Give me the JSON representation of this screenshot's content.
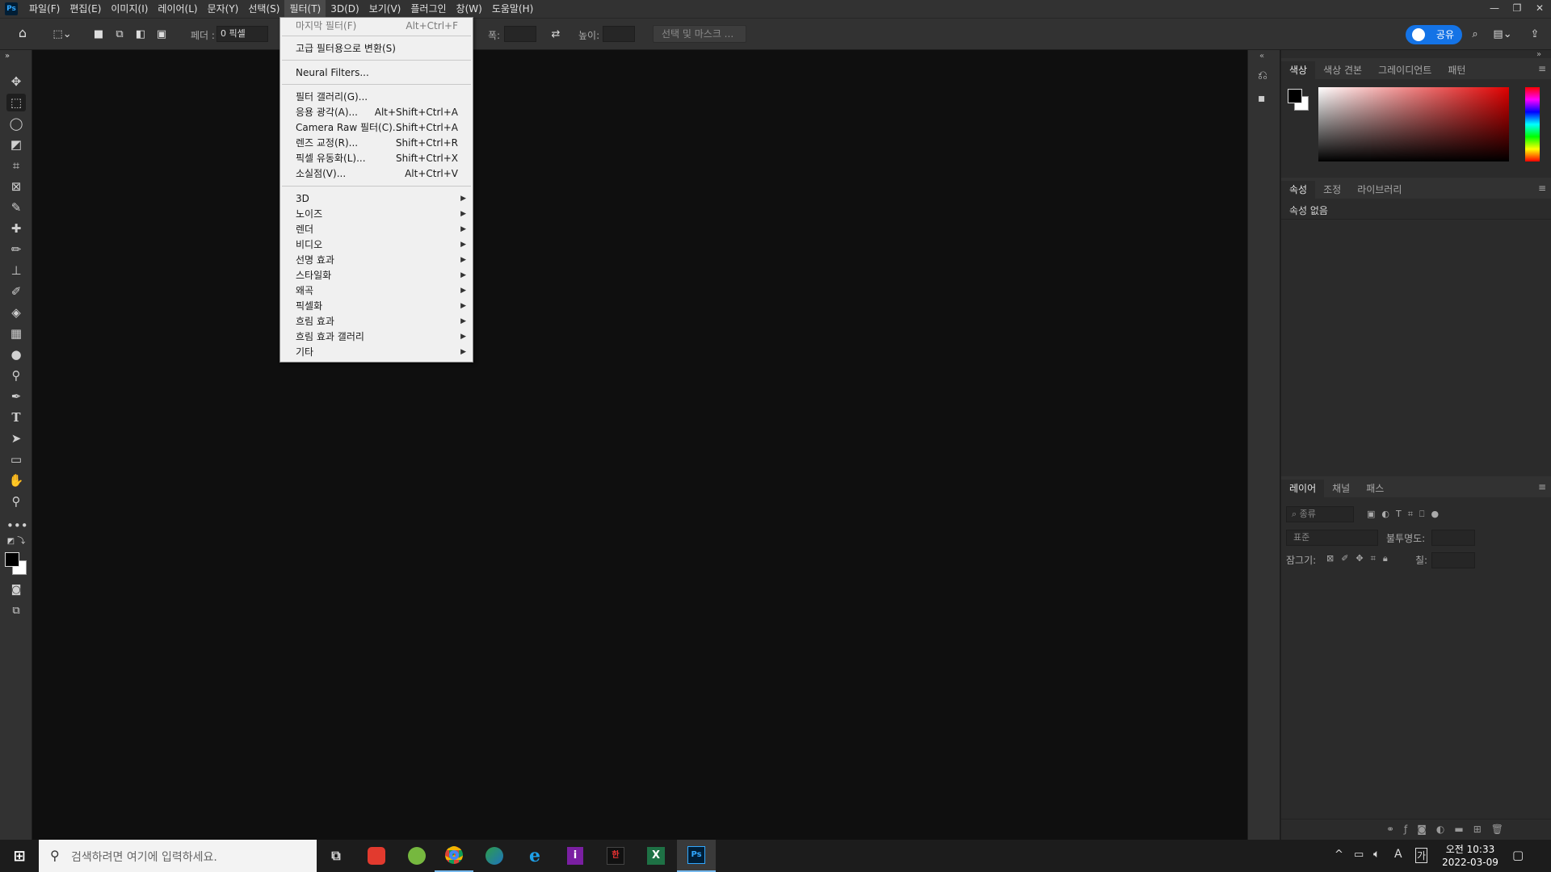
{
  "menubar": {
    "logo": "Ps",
    "items": [
      "파일(F)",
      "편집(E)",
      "이미지(I)",
      "레이어(L)",
      "문자(Y)",
      "선택(S)",
      "필터(T)",
      "3D(D)",
      "보기(V)",
      "플러그인",
      "창(W)",
      "도움말(H)"
    ],
    "window_controls": [
      "—",
      "❐",
      "✕"
    ]
  },
  "options": {
    "feather_label": "페더 :",
    "feather_value": "0 픽셀",
    "width_label": "폭:",
    "height_label": "높이:",
    "select_mask_label": "선택 및 마스크 ...",
    "share_label": "공유"
  },
  "filter_menu": {
    "last_filter": {
      "label": "마지막 필터(F)",
      "shortcut": "Alt+Ctrl+F"
    },
    "convert_smart": {
      "label": "고급 필터용으로 변환(S)"
    },
    "neural": {
      "label": "Neural Filters..."
    },
    "gallery": {
      "label": "필터 갤러리(G)..."
    },
    "adaptive": {
      "label": "응용 광각(A)...",
      "shortcut": "Alt+Shift+Ctrl+A"
    },
    "camera_raw": {
      "label": "Camera Raw 필터(C)...",
      "shortcut": "Shift+Ctrl+A"
    },
    "lens": {
      "label": "렌즈 교정(R)...",
      "shortcut": "Shift+Ctrl+R"
    },
    "liquify": {
      "label": "픽셀 유동화(L)...",
      "shortcut": "Shift+Ctrl+X"
    },
    "vanishing": {
      "label": "소실점(V)...",
      "shortcut": "Alt+Ctrl+V"
    },
    "submenus": [
      "3D",
      "노이즈",
      "렌더",
      "비디오",
      "선명 효과",
      "스타일화",
      "왜곡",
      "픽셀화",
      "흐림 효과",
      "흐림 효과 갤러리",
      "기타"
    ]
  },
  "color_panel": {
    "tabs": [
      "색상",
      "색상 견본",
      "그레이디언트",
      "패턴"
    ]
  },
  "properties_panel": {
    "tabs": [
      "속성",
      "조정",
      "라이브러리"
    ],
    "empty_text": "속성 없음"
  },
  "layers_panel": {
    "tabs": [
      "레이어",
      "채널",
      "패스"
    ],
    "filter_placeholder": "종류",
    "blend_mode": "표준",
    "opacity_label": "불투명도:",
    "lock_label": "잠그기:",
    "fill_label": "칠:"
  },
  "taskbar": {
    "search_placeholder": "검색하려면 여기에 입력하세요.",
    "time": "오전 10:33",
    "date": "2022-03-09",
    "ime": "A",
    "ime2": "가"
  },
  "colors": {
    "accent": "#1473e6",
    "menu_bg": "#f0f0f0",
    "panel_bg": "#2b2b2b",
    "chrome_bg": "#323232",
    "canvas_bg": "#0f0f0f"
  }
}
